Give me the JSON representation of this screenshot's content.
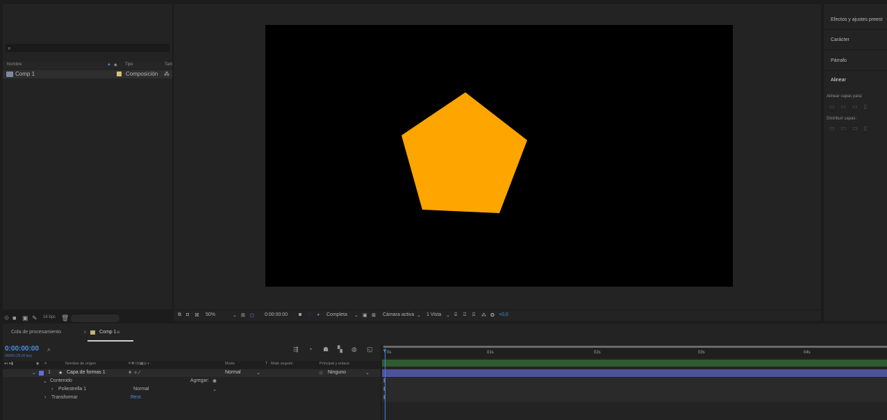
{
  "project": {
    "search_icon": "search-icon",
    "columns": {
      "name": "Nombre",
      "type": "Tipo",
      "size": "Tam"
    },
    "items": [
      {
        "name": "Comp 1",
        "type": "Composición"
      }
    ],
    "bottom_label": "16 bpc"
  },
  "viewer": {
    "zoom": "50%",
    "timecode": "0:00:00:00",
    "resolution": "Completa",
    "camera": "Cámara activa",
    "views": "1 Vista",
    "exposure": "+0,0",
    "shape_color": "#FFA500"
  },
  "right_panel": {
    "effects": "Efectos y ajustes preest",
    "character": "Carácter",
    "paragraph": "Párrafo",
    "align": "Alinear",
    "align_to": "Alinear capas para:",
    "distribute": "Distribuir capas:"
  },
  "timeline": {
    "tab_render": "Cola de procesamiento",
    "tab_comp": "Comp 1",
    "current_time": "0:00:00:00",
    "fps_label": "00000 (25.00 fps)",
    "headers": {
      "source": "Nombre de origen",
      "mode": "Modo",
      "t": "T",
      "matte": "Mate seguim.",
      "parent": "Principal y enlace"
    },
    "layer": {
      "number": "1",
      "name": "Capa de formas 1",
      "mode": "Normal",
      "parent": "Ninguno"
    },
    "content": "Contenido",
    "add_label": "Agregar:",
    "star": "Poliestrella 1",
    "star_mode": "Normal",
    "transform": "Transformar",
    "reset": "Rest.",
    "ruler": [
      "0s",
      "01s",
      "02s",
      "03s",
      "04s"
    ]
  }
}
